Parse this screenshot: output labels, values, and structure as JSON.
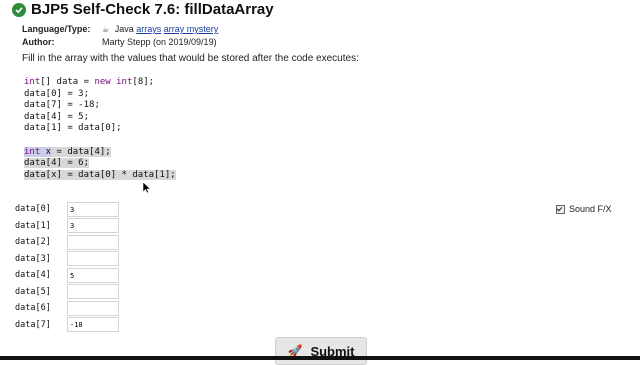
{
  "header": {
    "title": "BJP5 Self-Check 7.6: fillDataArray",
    "language_label": "Language/Type:",
    "language_value": "Java",
    "tag1": "arrays",
    "tag2": "array mystery",
    "author_label": "Author:",
    "author_value": "Marty Stepp (on 2019/09/19)"
  },
  "instructions": "Fill in the array with the values that would be stored after the code executes:",
  "code_lines": [
    "int[] data = new int[8];",
    "data[0] = 3;",
    "data[7] = -18;",
    "data[4] = 5;",
    "data[1] = data[0];",
    "",
    "int x = data[4];",
    "data[4] = 6;",
    "data[x] = data[0] * data[1];"
  ],
  "fields": [
    {
      "label": "data[0]",
      "value": "3"
    },
    {
      "label": "data[1]",
      "value": "3"
    },
    {
      "label": "data[2]",
      "value": ""
    },
    {
      "label": "data[3]",
      "value": ""
    },
    {
      "label": "data[4]",
      "value": "5"
    },
    {
      "label": "data[5]",
      "value": ""
    },
    {
      "label": "data[6]",
      "value": ""
    },
    {
      "label": "data[7]",
      "value": "-18"
    }
  ],
  "sound": {
    "label": "Sound F/X",
    "checked": true
  },
  "submit": {
    "label": "Submit"
  },
  "colors": {
    "success": "#2e8b3a",
    "link": "#1a3f9e",
    "keyword": "#7a0a7a"
  },
  "icons": {
    "status": "check-circle-icon",
    "language": "java-icon",
    "submit": "rocket-icon"
  }
}
